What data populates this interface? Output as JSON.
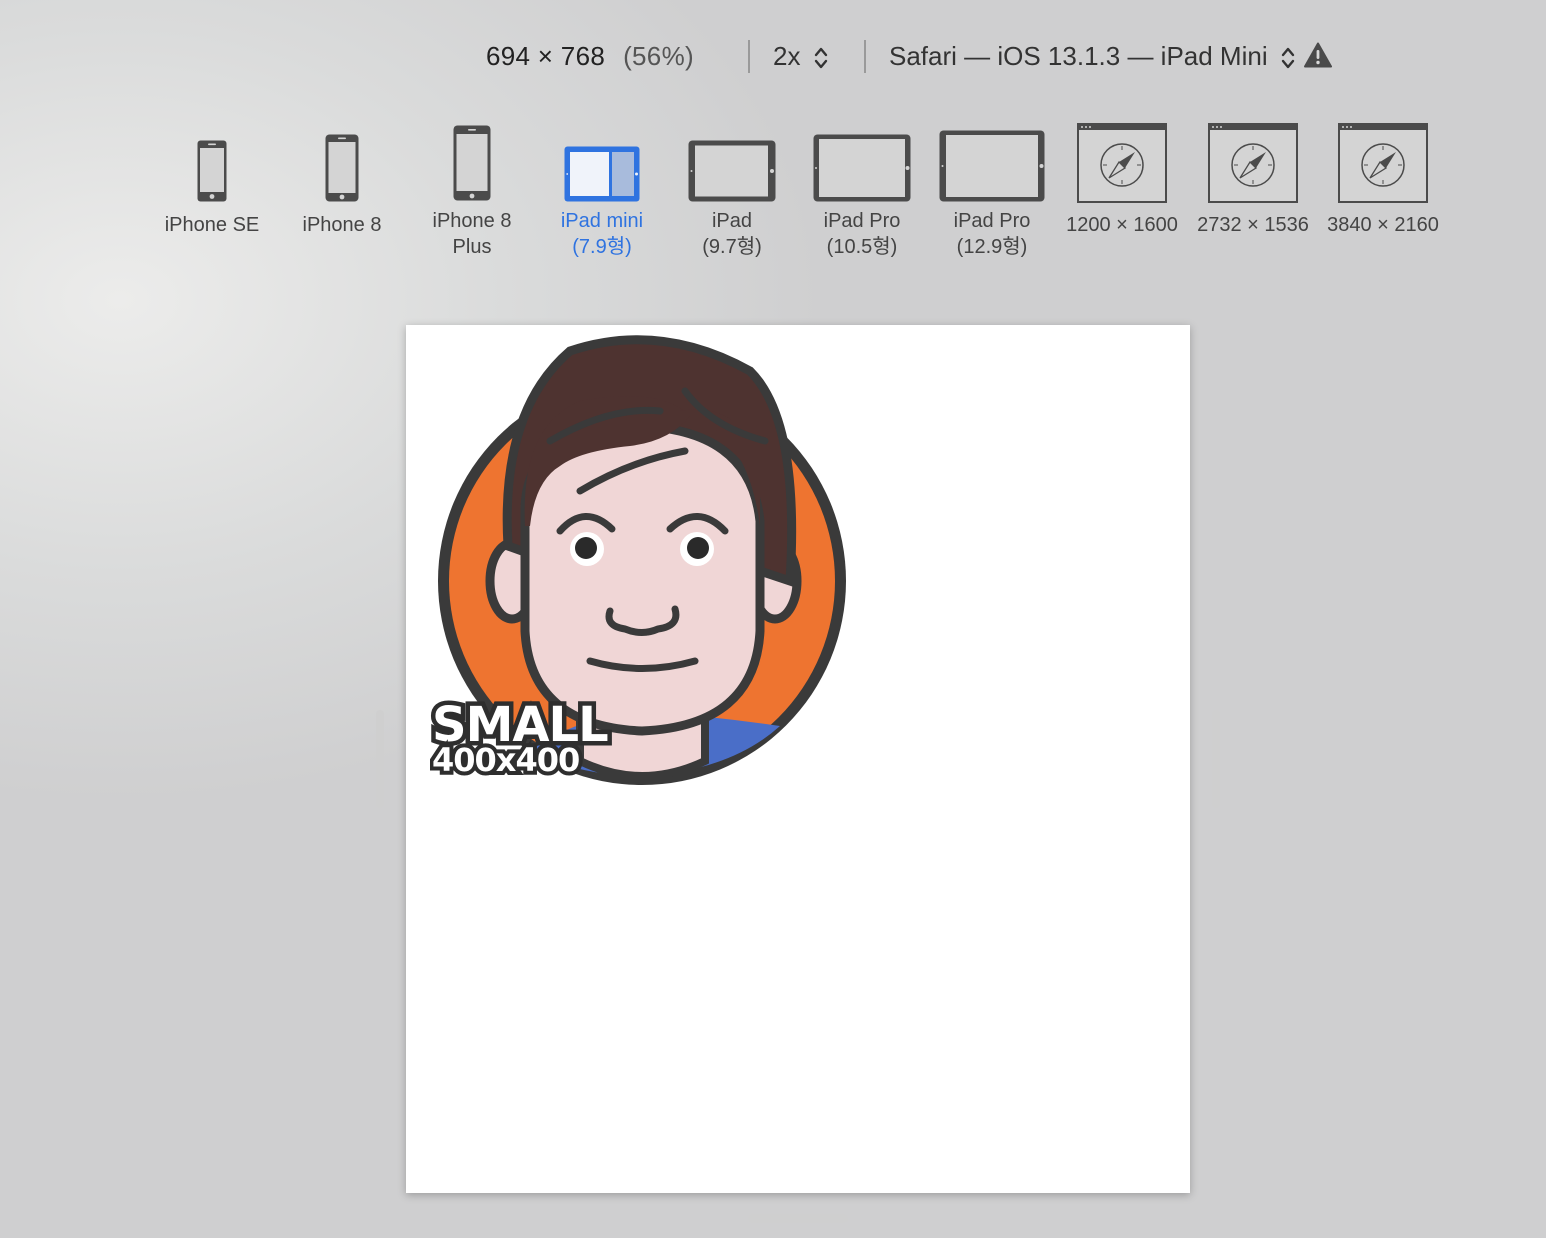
{
  "toolbar": {
    "dimensions": "694 × 768",
    "zoom": "(56%)",
    "pixel_ratio": "2x",
    "user_agent": "Safari — iOS 13.1.3 — iPad Mini",
    "warning_icon": "warning-triangle-icon"
  },
  "devices": [
    {
      "line1": "iPhone SE",
      "line2": "",
      "icon": "phone-icon"
    },
    {
      "line1": "iPhone 8",
      "line2": "",
      "icon": "phone-icon"
    },
    {
      "line1": "iPhone 8",
      "line2": "Plus",
      "icon": "phone-icon"
    },
    {
      "line1": "iPad mini",
      "line2": "(7.9형)",
      "icon": "tablet-split-icon",
      "selected": true
    },
    {
      "line1": "iPad",
      "line2": "(9.7형)",
      "icon": "tablet-icon"
    },
    {
      "line1": "iPad Pro",
      "line2": "(10.5형)",
      "icon": "tablet-icon"
    },
    {
      "line1": "iPad Pro",
      "line2": "(12.9형)",
      "icon": "tablet-icon"
    },
    {
      "line1": "1200 × 1600",
      "line2": "",
      "icon": "safari-window-icon"
    },
    {
      "line1": "2732 × 1536",
      "line2": "",
      "icon": "safari-window-icon"
    },
    {
      "line1": "3840 × 2160",
      "line2": "",
      "icon": "safari-window-icon"
    }
  ],
  "viewport": {
    "image_label_line1": "SMALL",
    "image_label_line2": "400x400"
  },
  "colors": {
    "accent": "#2f73e0",
    "avatar_ring": "#ee7430",
    "avatar_hair": "#4e3330",
    "avatar_skin": "#f0d6d6",
    "avatar_shirt": "#4a6ec8"
  }
}
